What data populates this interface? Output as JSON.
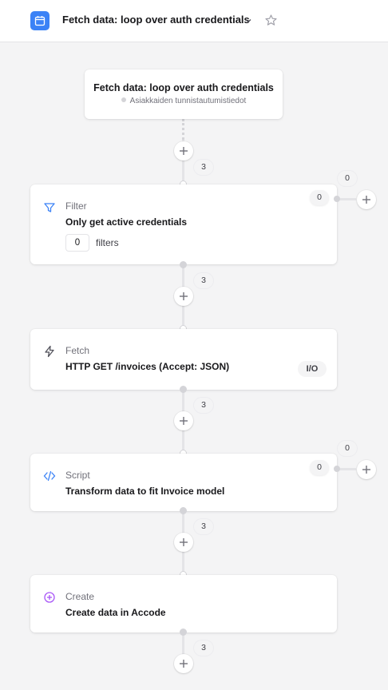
{
  "header": {
    "title": "Fetch data: loop over auth credentials",
    "app_icon": "calendar-icon",
    "chevron_icon": "chevron-down-icon",
    "star_icon": "star-icon",
    "accent_color": "#3b82f6"
  },
  "trigger": {
    "title": "Fetch data: loop over auth credentials",
    "subtitle": "Asiakkaiden tunnistautumistiedot"
  },
  "steps": [
    {
      "type": "Filter",
      "description": "Only get active credentials",
      "icon": "filter-icon",
      "icon_color": "#3b82f6",
      "filters_count": "0",
      "filters_label": "filters",
      "branch_in_count": "0",
      "branch_out_count": "0"
    },
    {
      "type": "Fetch",
      "description": "HTTP GET /invoices (Accept: JSON)",
      "icon": "lightning-icon",
      "icon_color": "#52525b",
      "badge": "I/O"
    },
    {
      "type": "Script",
      "description": "Transform data to fit Invoice model",
      "icon": "code-icon",
      "icon_color": "#3b82f6",
      "branch_in_count": "0",
      "branch_out_count": "0"
    },
    {
      "type": "Create",
      "description": "Create data in Accode",
      "icon": "plus-circle-icon",
      "icon_color": "#a855f7"
    }
  ],
  "connectors": [
    {
      "count": "3"
    },
    {
      "count": "3"
    },
    {
      "count": "3"
    },
    {
      "count": "3"
    },
    {
      "count": "3"
    }
  ]
}
